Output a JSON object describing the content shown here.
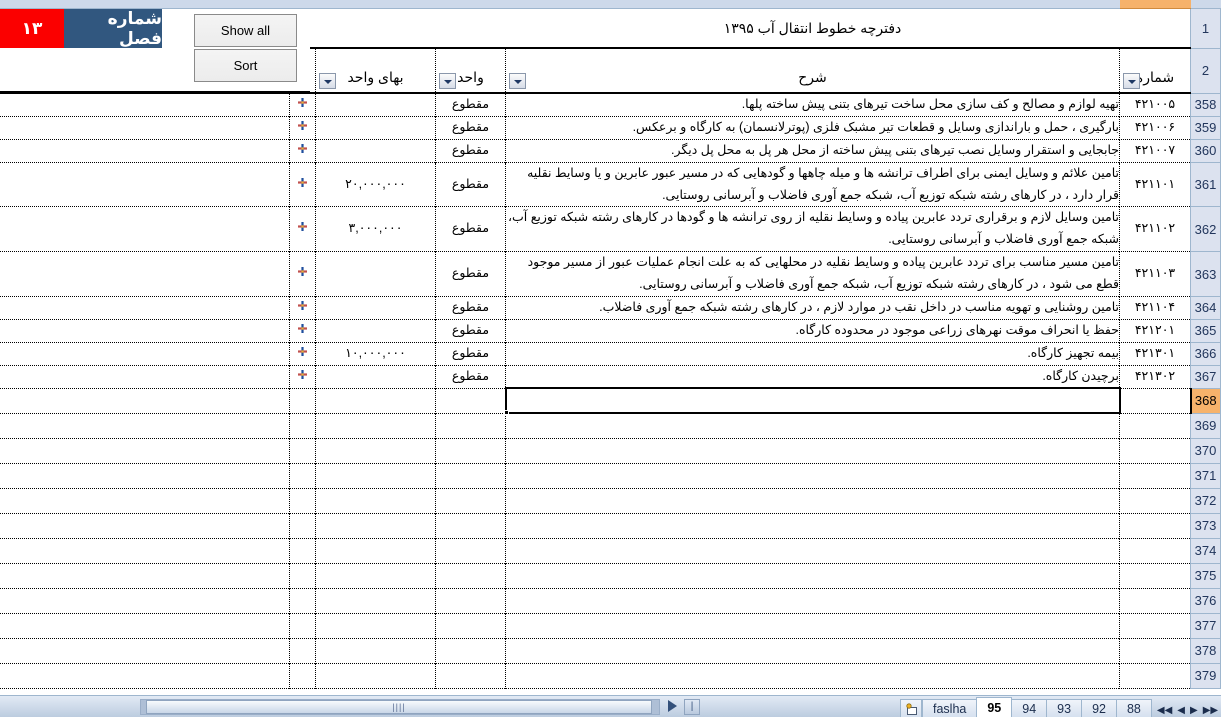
{
  "window": {
    "title": "دفترچه خطوط انتقال آب ۱۳۹۵"
  },
  "toolpanel": {
    "chapter_label": "شماره فصل",
    "chapter_number": "۱۳",
    "chapter_label_bg": "#31577f",
    "chapter_number_bg": "#fb0000",
    "show_all_button": "Show all",
    "sort_button": "Sort"
  },
  "headers": {
    "title": "دفترچه خطوط انتقال آب ۱۳۹۵",
    "number": "شماره",
    "description": "شرح",
    "unit": "واحد",
    "unit_price": "بهای واحد",
    "filter_icon": "chevron-down-icon"
  },
  "row_numbers_top": [
    "1",
    "2"
  ],
  "rows": [
    {
      "rowhdr": "358",
      "number": "۴۲۱۰۰۵",
      "description": "تهیه لوازم و مصالح و کف سازی محل ساخت تیرهای بتنی پیش ساخته پلها.",
      "unit": "مقطوع",
      "price": "",
      "star": "*"
    },
    {
      "rowhdr": "359",
      "number": "۴۲۱۰۰۶",
      "description": "بارگیری ، حمل و باراندازی وسایل و قطعات تیر مشبک فلزی (پوترلانسمان) به کارگاه و برعکس.",
      "unit": "مقطوع",
      "price": "",
      "star": "*"
    },
    {
      "rowhdr": "360",
      "number": "۴۲۱۰۰۷",
      "description": "جابجایی و استقرار وسایل نصب تیرهای بتنی پیش ساخته از محل هر پل به محل پل دیگر.",
      "unit": "مقطوع",
      "price": "",
      "star": "*"
    },
    {
      "rowhdr": "361",
      "number": "۴۲۱۱۰۱",
      "description": "تامین علائم و وسایل ایمنی برای اطراف ترانشه ها و میله چاهها و گودهایی که در مسیر عبور عابرین و یا وسایط نقلیه قرار دارد ، در کارهای رشته شبکه توزیع آب، شبکه جمع آوری فاضلاب و آبرسانی روستایی.",
      "unit": "مقطوع",
      "price": "۲۰,۰۰۰,۰۰۰",
      "star": "*"
    },
    {
      "rowhdr": "362",
      "number": "۴۲۱۱۰۲",
      "description": "تامین وسایل لازم و برقراری تردد عابرین پیاده و وسایط نقلیه از روی ترانشه ها و گودها در کارهای رشته شبکه توزیع آب، شبکه جمع آوری فاضلاب و آبرسانی روستایی.",
      "unit": "مقطوع",
      "price": "۳,۰۰۰,۰۰۰",
      "star": "*"
    },
    {
      "rowhdr": "363",
      "number": "۴۲۱۱۰۳",
      "description": "تامین مسیر مناسب برای تردد عابرین پیاده و وسایط نقلیه در محلهایی که به علت انجام عملیات عبور از مسیر موجود قطع می شود ، در کارهای رشته شبکه توزیع آب، شبکه جمع آوری فاضلاب و آبرسانی روستایی.",
      "unit": "مقطوع",
      "price": "",
      "star": "*"
    },
    {
      "rowhdr": "364",
      "number": "۴۲۱۱۰۴",
      "description": "تامین روشنایی و تهویه مناسب در داخل نقب در موارد لازم ، در کارهای رشته شبکه جمع آوری فاضلاب.",
      "unit": "مقطوع",
      "price": "",
      "star": "*"
    },
    {
      "rowhdr": "365",
      "number": "۴۲۱۲۰۱",
      "description": "حفظ یا انحراف موقت نهرهای زراعی موجود در محدوده کارگاه.",
      "unit": "مقطوع",
      "price": "",
      "star": "*"
    },
    {
      "rowhdr": "366",
      "number": "۴۲۱۳۰۱",
      "description": "بیمه تجهیز کارگاه.",
      "unit": "مقطوع",
      "price": "۱۰,۰۰۰,۰۰۰",
      "star": "*"
    },
    {
      "rowhdr": "367",
      "number": "۴۲۱۳۰۲",
      "description": "برچیدن کارگاه.",
      "unit": "مقطوع",
      "price": "",
      "star": "*"
    }
  ],
  "empty_rows": [
    "368",
    "369",
    "370",
    "371",
    "372",
    "373",
    "374",
    "375",
    "376",
    "377",
    "378",
    "379"
  ],
  "active_row": "368",
  "statusbar": {
    "scroll_grip": "||||",
    "split_handle": "|",
    "gear_tab_icon": "gear-sheet-icon",
    "tabs": [
      {
        "label": "faslha",
        "active": false
      },
      {
        "label": "95",
        "active": true
      },
      {
        "label": "94",
        "active": false
      },
      {
        "label": "93",
        "active": false
      },
      {
        "label": "92",
        "active": false
      },
      {
        "label": "88",
        "active": false
      }
    ],
    "nav": {
      "first": "◀◀",
      "prev": "◀",
      "next": "▶",
      "last": "▶▶"
    }
  },
  "colors": {
    "header_strip": "#cdd9ea",
    "selection_orange": "#f6b26b",
    "rowhdr_bg": "#dce2ef",
    "grid_line": "#000000"
  }
}
